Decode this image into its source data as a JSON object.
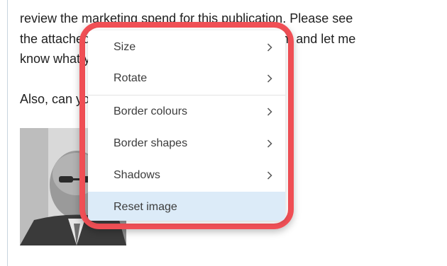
{
  "email": {
    "lines": [
      "review the marketing spend for this publication. Please see",
      "the attached document from our marketing team and let me",
      "know what you think.",
      "Also, can you add this to your list?"
    ]
  },
  "context_menu": {
    "items": [
      {
        "label": "Size",
        "has_submenu": true
      },
      {
        "label": "Rotate",
        "has_submenu": true
      },
      {
        "label": "Border colours",
        "has_submenu": true
      },
      {
        "label": "Border shapes",
        "has_submenu": true
      },
      {
        "label": "Shadows",
        "has_submenu": true
      },
      {
        "label": "Reset image",
        "has_submenu": false,
        "highlighted": true
      }
    ]
  },
  "colors": {
    "highlight_outline": "#f04f55",
    "hover_row": "#dcebf8"
  }
}
